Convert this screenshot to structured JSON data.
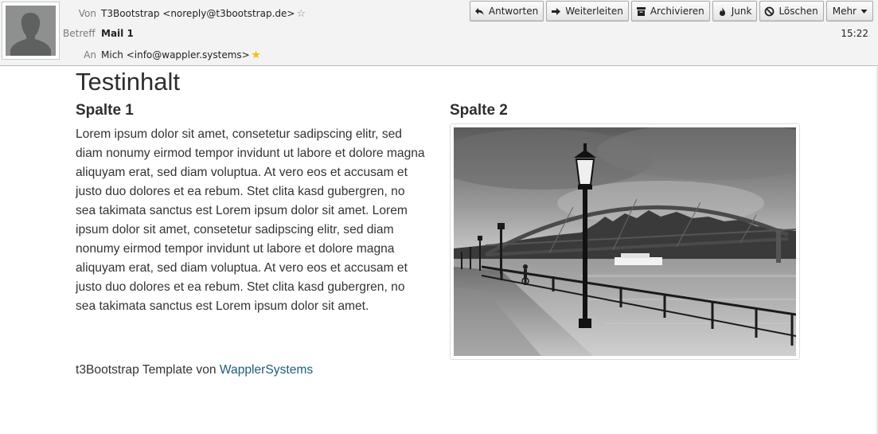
{
  "header": {
    "from_label": "Von",
    "from_value": "T3Bootstrap <noreply@t3bootstrap.de>",
    "subject_label": "Betreff",
    "subject_value": "Mail 1",
    "to_label": "An",
    "to_value": "Mich <info@wappler.systems>",
    "time": "15:22"
  },
  "toolbar": {
    "reply": "Antworten",
    "forward": "Weiterleiten",
    "archive": "Archivieren",
    "junk": "Junk",
    "delete": "Löschen",
    "more": "Mehr"
  },
  "icons": {
    "avatar": "person-silhouette-icon",
    "from_star": "star-outline-icon",
    "to_star": "star-filled-icon",
    "reply": "reply-arrow-icon",
    "forward": "forward-arrow-icon",
    "archive": "archive-box-icon",
    "junk": "flame-icon",
    "delete": "prohibited-icon",
    "more": "caret-down-icon"
  },
  "body": {
    "title": "Testinhalt",
    "col1_title": "Spalte 1",
    "col1_text": "Lorem ipsum dolor sit amet, consetetur sadipscing elitr, sed diam nonumy eirmod tempor invidunt ut labore et dolore magna aliquyam erat, sed diam voluptua. At vero eos et accusam et justo duo dolores et ea rebum. Stet clita kasd gubergren, no sea takimata sanctus est Lorem ipsum dolor sit amet. Lorem ipsum dolor sit amet, consetetur sadipscing elitr, sed diam nonumy eirmod tempor invidunt ut labore et dolore magna aliquyam erat, sed diam voluptua. At vero eos et accusam et justo duo dolores et ea rebum. Stet clita kasd gubergren, no sea takimata sanctus est Lorem ipsum dolor sit amet.",
    "col2_title": "Spalte 2",
    "footer_text": "t3Bootstrap Template von ",
    "footer_link": "WapplerSystems"
  },
  "colors": {
    "link": "#1d5d73",
    "star": "#f2c200",
    "header_bg": "#f3f3f3"
  }
}
